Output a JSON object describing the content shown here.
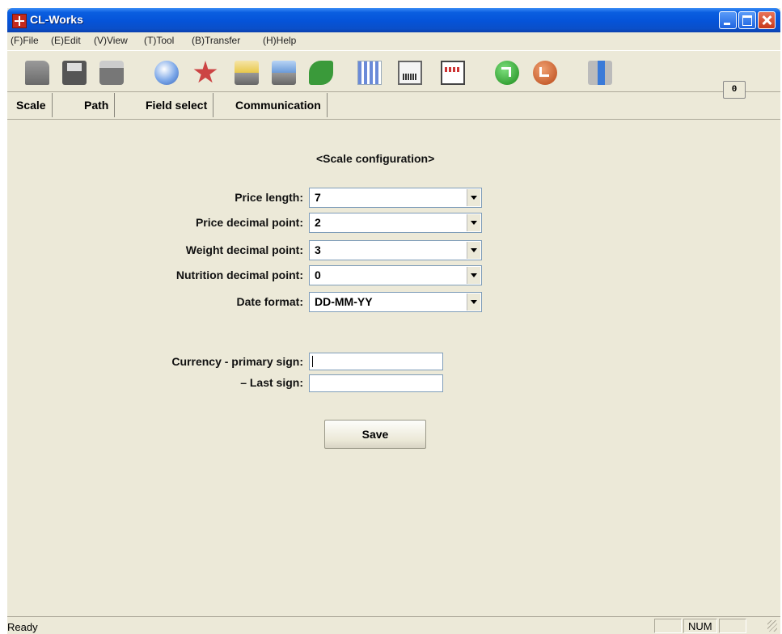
{
  "window": {
    "title": "CL-Works"
  },
  "menu": {
    "file": "(F)File",
    "edit": "(E)Edit",
    "view": "(V)View",
    "tool": "(T)Tool",
    "transfer": "(B)Transfer",
    "help": "(H)Help"
  },
  "toolbar": {
    "icons": [
      "open-folder",
      "save",
      "print",
      "globe",
      "star",
      "tray-upload",
      "tray-download",
      "leaf",
      "grid",
      "label",
      "keyboard",
      "arrow-up",
      "arrow-down",
      "tools"
    ],
    "zero_label": "0"
  },
  "tabs": [
    "Scale",
    "Path",
    "Field select",
    "Communication"
  ],
  "form": {
    "heading": "<Scale configuration>",
    "price_length_label": "Price length:",
    "price_length_value": "7",
    "price_decimal_label": "Price decimal point:",
    "price_decimal_value": "2",
    "weight_decimal_label": "Weight decimal point:",
    "weight_decimal_value": "3",
    "nutrition_decimal_label": "Nutrition decimal point:",
    "nutrition_decimal_value": "0",
    "date_format_label": "Date format:",
    "date_format_value": "DD-MM-YY",
    "currency_primary_label": "Currency - primary sign:",
    "currency_primary_value": "",
    "currency_last_label": "– Last sign:",
    "currency_last_value": "",
    "save_label": "Save"
  },
  "status": {
    "text": "Ready",
    "num": "NUM"
  }
}
